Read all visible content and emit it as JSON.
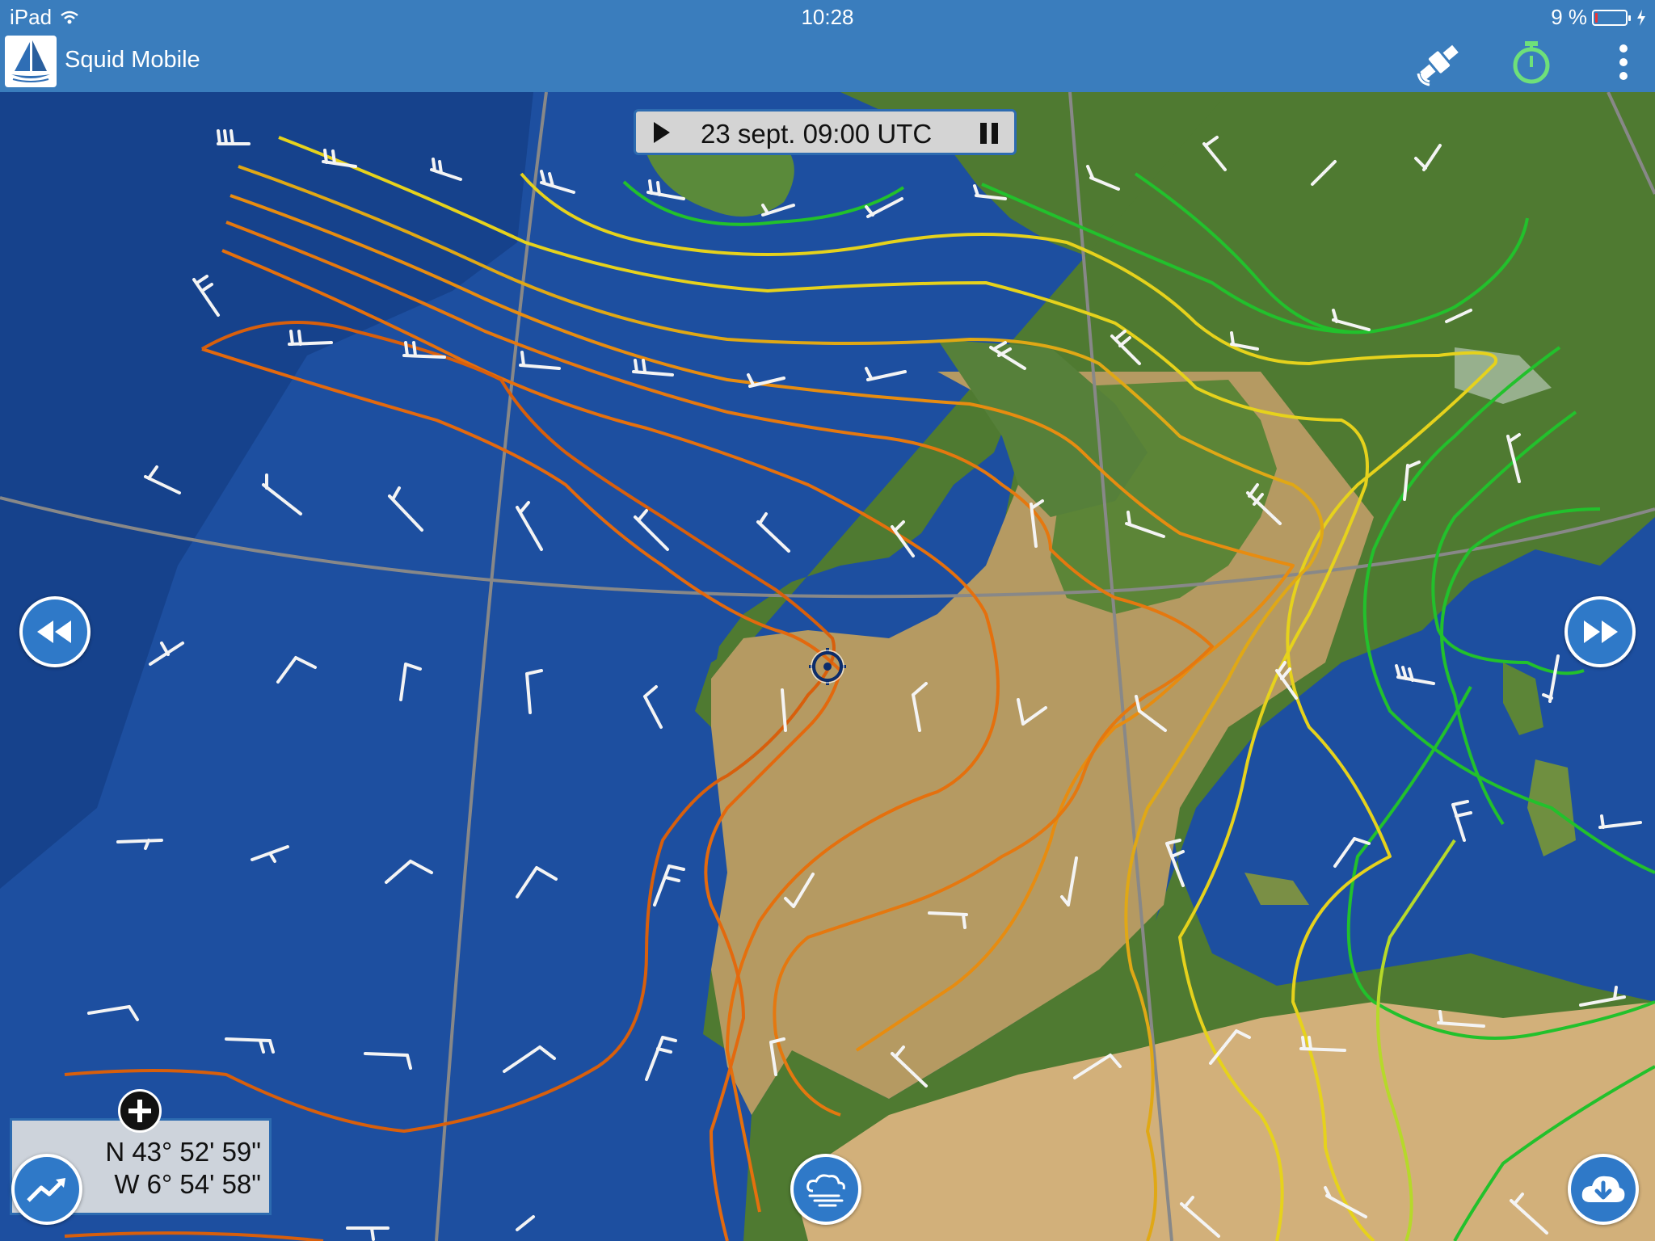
{
  "status_bar": {
    "device": "iPad",
    "time": "10:28",
    "battery_text": "9 %",
    "battery_level": 0.09,
    "icons": [
      "wifi-icon",
      "battery-icon",
      "charging-icon"
    ]
  },
  "app_bar": {
    "logo_icon": "sailboat-logo-icon",
    "title": "Squid Mobile",
    "actions": [
      {
        "name": "satellite-button",
        "icon": "satellite-icon"
      },
      {
        "name": "timer-button",
        "icon": "stopwatch-icon",
        "color": "#6ee07a"
      },
      {
        "name": "overflow-menu-button",
        "icon": "more-vertical-icon"
      }
    ]
  },
  "timeline": {
    "label": "23 sept. 09:00 UTC",
    "play_icon": "play-icon",
    "pause_icon": "pause-icon"
  },
  "map": {
    "layer": "wind-barbs-and-isolines",
    "cursor_icon": "crosshair-target-icon",
    "colors": {
      "water": "#1d4fa0",
      "land": "#4f7a31",
      "isoline_orange": "#e3690e",
      "isoline_yellow": "#e6d21c",
      "isoline_green": "#22c12c",
      "barb": "#ffffff",
      "graticule": "#777777"
    }
  },
  "controls": {
    "previous": {
      "icon": "rewind-icon"
    },
    "next": {
      "icon": "fast-forward-icon"
    },
    "zoom_in": {
      "icon": "plus-icon"
    },
    "chart": {
      "icon": "trend-chart-icon"
    },
    "weather": {
      "icon": "cloud-wind-icon"
    },
    "download": {
      "icon": "cloud-download-icon"
    }
  },
  "coordinates": {
    "lat": "N 43° 52' 59\"",
    "lon": "W 6° 54' 58\""
  }
}
